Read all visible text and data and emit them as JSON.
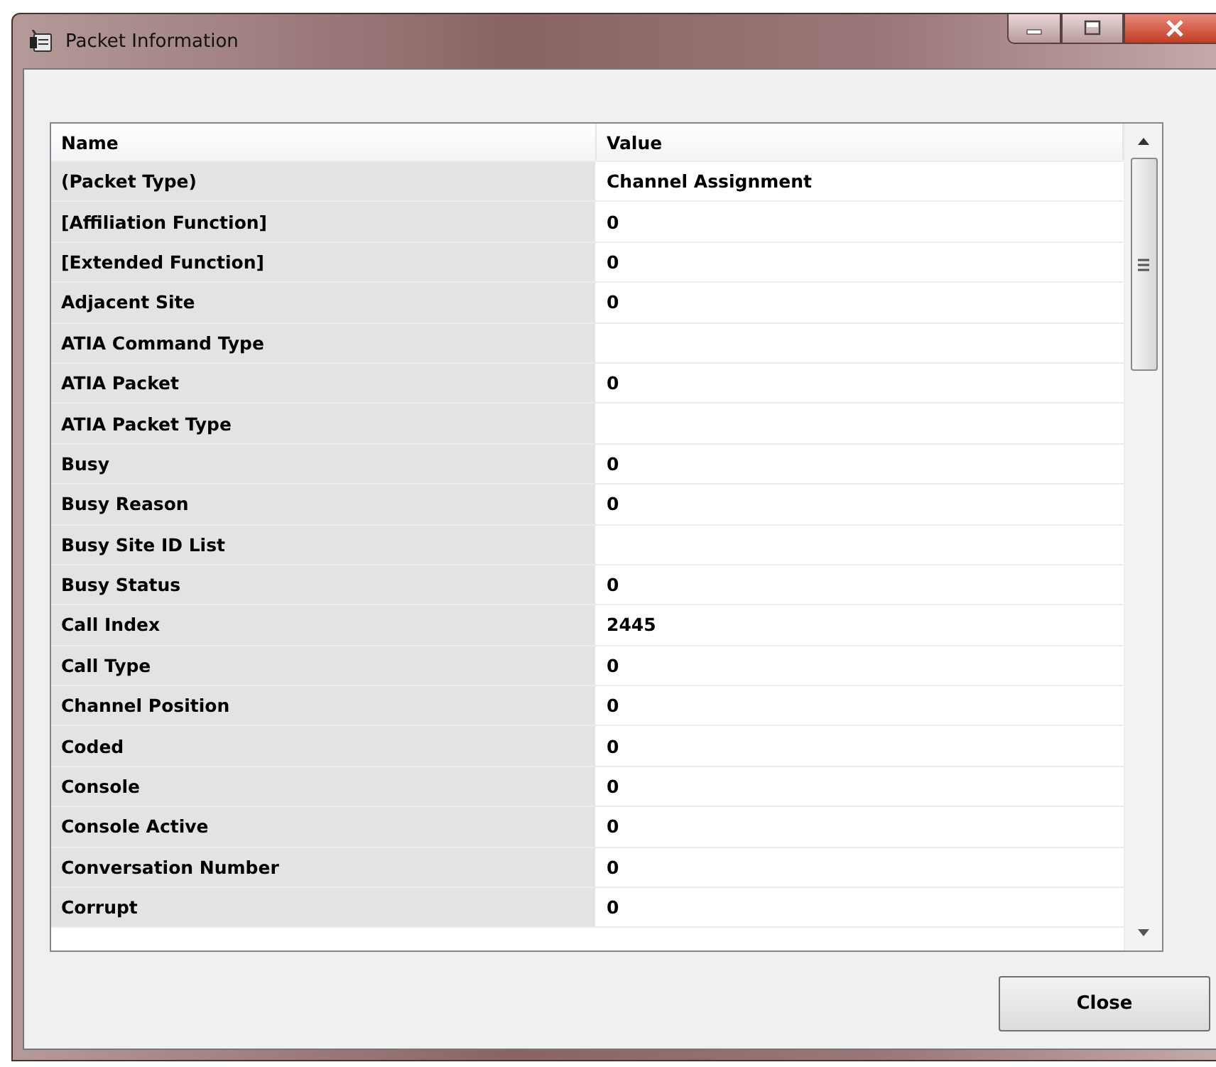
{
  "window": {
    "title": "Packet Information"
  },
  "table": {
    "columns": [
      "Name",
      "Value"
    ],
    "rows": [
      {
        "name": "(Packet Type)",
        "value": "Channel Assignment"
      },
      {
        "name": "[Affiliation Function]",
        "value": "0"
      },
      {
        "name": "[Extended Function]",
        "value": "0"
      },
      {
        "name": "Adjacent Site",
        "value": "0"
      },
      {
        "name": "ATIA Command Type",
        "value": ""
      },
      {
        "name": "ATIA Packet",
        "value": "0"
      },
      {
        "name": "ATIA Packet Type",
        "value": ""
      },
      {
        "name": "Busy",
        "value": "0"
      },
      {
        "name": "Busy Reason",
        "value": "0"
      },
      {
        "name": "Busy Site ID List",
        "value": ""
      },
      {
        "name": "Busy Status",
        "value": "0"
      },
      {
        "name": "Call Index",
        "value": "2445"
      },
      {
        "name": "Call Type",
        "value": "0"
      },
      {
        "name": "Channel Position",
        "value": "0"
      },
      {
        "name": "Coded",
        "value": "0"
      },
      {
        "name": "Console",
        "value": "0"
      },
      {
        "name": "Console Active",
        "value": "0"
      },
      {
        "name": "Conversation Number",
        "value": "0"
      },
      {
        "name": "Corrupt",
        "value": "0"
      }
    ]
  },
  "buttons": [
    "Close"
  ]
}
